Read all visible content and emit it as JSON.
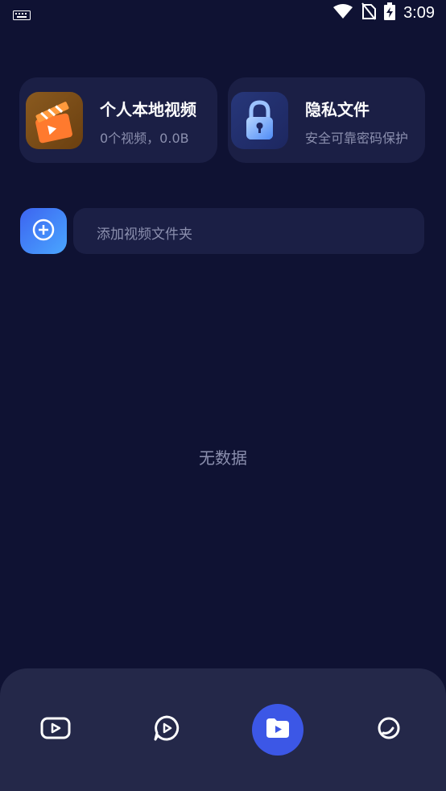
{
  "status_bar": {
    "time": "3:09",
    "icons": [
      "keyboard-icon",
      "wifi-icon",
      "no-sim-icon",
      "battery-charging-icon"
    ]
  },
  "cards": {
    "local": {
      "title": "个人本地视频",
      "subtitle": "0个视频，0.0B",
      "icon": "clapperboard-icon"
    },
    "private": {
      "title": "隐私文件",
      "subtitle": "安全可靠密码保护",
      "icon": "lock-icon"
    }
  },
  "add_folder": {
    "label": "添加视频文件夹",
    "icon": "plus-circle-icon"
  },
  "empty_state": "无数据",
  "bottom_nav": [
    {
      "icon": "video-play-icon",
      "active": false
    },
    {
      "icon": "chat-play-icon",
      "active": false
    },
    {
      "icon": "folder-play-icon",
      "active": true
    },
    {
      "icon": "circle-profile-icon",
      "active": false
    }
  ],
  "colors": {
    "background": "#0f1233",
    "card": "#1b1f45",
    "accent": "#3c57e6",
    "muted_text": "#8b8fae",
    "nav_bg": "#242849"
  }
}
